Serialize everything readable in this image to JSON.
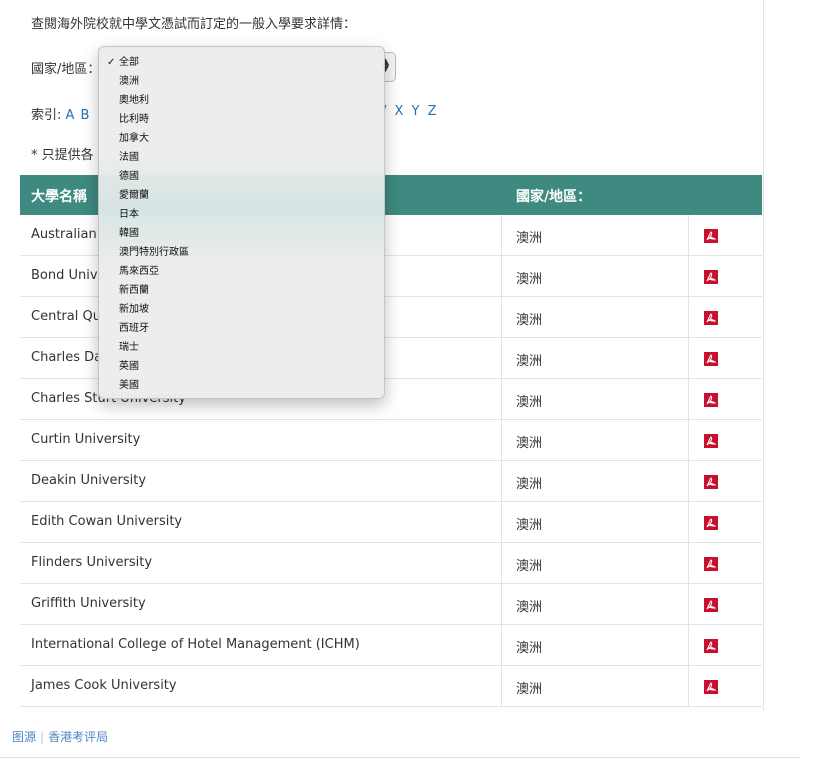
{
  "intro": "查閱海外院校就中學文憑試而訂定的一般入學要求詳情：",
  "filter": {
    "label": "國家/地區：",
    "selected": "全部"
  },
  "index": {
    "label": "索引:",
    "letters_visible": "A B",
    "letters_tail": "/ X Y Z"
  },
  "note": "* 只提供各",
  "table": {
    "headers": [
      "大學名稱",
      "國家/地區："
    ],
    "rows": [
      {
        "name": "Australian",
        "country": "澳洲"
      },
      {
        "name": "Bond Unive",
        "country": "澳洲"
      },
      {
        "name": "Central Qu",
        "country": "澳洲"
      },
      {
        "name": "Charles Da",
        "country": "澳洲"
      },
      {
        "name": "Charles Sturt University",
        "country": "澳洲"
      },
      {
        "name": "Curtin University",
        "country": "澳洲"
      },
      {
        "name": "Deakin University",
        "country": "澳洲"
      },
      {
        "name": "Edith Cowan University",
        "country": "澳洲"
      },
      {
        "name": "Flinders University",
        "country": "澳洲"
      },
      {
        "name": "Griffith University",
        "country": "澳洲"
      },
      {
        "name": "International College of Hotel Management (ICHM)",
        "country": "澳洲"
      },
      {
        "name": "James Cook University",
        "country": "澳洲"
      }
    ]
  },
  "dropdown": {
    "options": [
      "全部",
      "澳洲",
      "奧地利",
      "比利時",
      "加拿大",
      "法國",
      "德國",
      "愛爾蘭",
      "日本",
      "韓國",
      "澳門特別行政區",
      "馬來西亞",
      "新西蘭",
      "新加坡",
      "西班牙",
      "瑞士",
      "英國",
      "美國"
    ],
    "checkmark": "✓"
  },
  "source": {
    "left": "图源",
    "sep": "|",
    "right": "香港考评局"
  },
  "colors": {
    "header_bg": "#3e8a80",
    "link": "#2a6fb5",
    "pdf_red": "#c8102e"
  },
  "icons": {
    "pdf": "pdf-icon",
    "select": "select-arrows-icon"
  }
}
